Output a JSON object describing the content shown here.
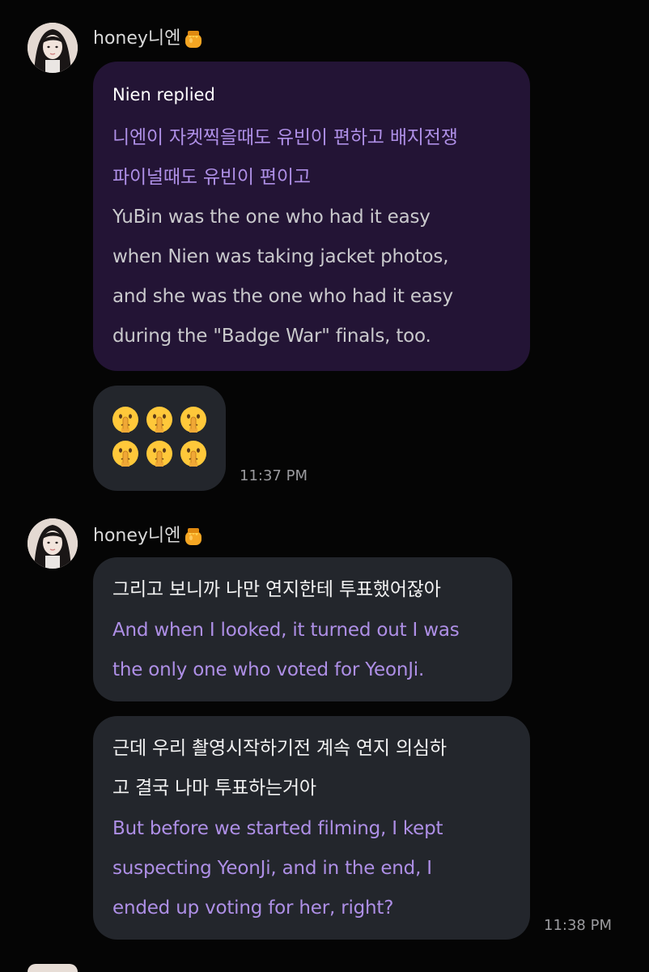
{
  "messages": [
    {
      "sender": "honey니엔",
      "sender_icon": "honey-pot-icon",
      "reply": {
        "label": "Nien replied",
        "korean": [
          "니엔이 자켓찍을때도 유빈이 편하고 배지전쟁",
          "파이널때도 유빈이 편이고"
        ],
        "english": [
          "YuBin was the one who had it easy",
          "when Nien was taking jacket photos,",
          "and she was the one who had it easy",
          "during the \"Badge War\" finals, too."
        ]
      },
      "emoji_bubble": {
        "emoji": "shushing-face-icon",
        "count": 6
      },
      "time": "11:37 PM"
    },
    {
      "sender": "honey니엔",
      "sender_icon": "honey-pot-icon",
      "bubbles": [
        {
          "korean": [
            "그리고 보니까 나만 연지한테 투표했어잖아"
          ],
          "english": [
            "And when I looked, it turned out I was",
            "the only one who voted for YeonJi."
          ]
        },
        {
          "korean": [
            "근데 우리 촬영시작하기전 계속 연지 의심하",
            "고 결국 나마 투표하는거아"
          ],
          "english": [
            "But before we started filming, I kept",
            "suspecting YeonJi, and in the end, I",
            "ended up voting for her, right?"
          ]
        }
      ],
      "time": "11:38 PM"
    }
  ],
  "colors": {
    "background": "#050505",
    "bubble_gray": "#23262c",
    "bubble_reply": "#231435",
    "purple_text": "#ae8fe6"
  }
}
